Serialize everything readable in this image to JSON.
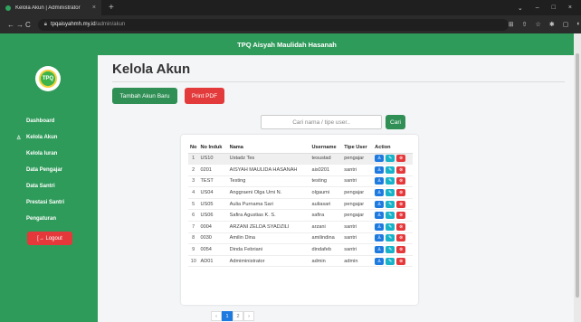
{
  "browser": {
    "tab_title": "Kelola Akun | Administrator",
    "tab_close": "×",
    "new_tab": "+",
    "url_host": "tpqaisyahmh.my.id",
    "url_path": "/admin/akun",
    "window_controls": [
      "⌄",
      "–",
      "□",
      "×"
    ]
  },
  "app": {
    "brand_title": "TPQ Aisyah Maulidah Hasanah",
    "logo_text": "TPQ",
    "sidebar": {
      "items": [
        {
          "label": "Dashboard",
          "icon": ""
        },
        {
          "label": "Kelola Akun",
          "icon": "user-icon"
        },
        {
          "label": "Kelola Iuran",
          "icon": ""
        },
        {
          "label": "Data Pengajar",
          "icon": ""
        },
        {
          "label": "Data Santri",
          "icon": ""
        },
        {
          "label": "Prestasi Santri",
          "icon": ""
        },
        {
          "label": "Pengaturan",
          "icon": ""
        }
      ],
      "logout_label": "[→ Logout"
    },
    "page_title": "Kelola Akun",
    "buttons": {
      "add_account": "Tambah Akun Baru",
      "print_pdf": "Print PDF"
    },
    "search": {
      "placeholder": "Cari nama / tipe user..",
      "button": "Cari"
    },
    "table": {
      "columns": [
        "No",
        "No Induk",
        "Nama",
        "Username",
        "Tipe User",
        "Action"
      ],
      "rows": [
        {
          "no": "1",
          "induk": "US10",
          "nama": "Ustadz Tes",
          "username": "tesustad",
          "tipe": "pengajar"
        },
        {
          "no": "2",
          "induk": "0201",
          "nama": "AISYAH MAULIDA HASANAH",
          "username": "ais0201",
          "tipe": "santri"
        },
        {
          "no": "3",
          "induk": "TEST",
          "nama": "Testing",
          "username": "testing",
          "tipe": "santri"
        },
        {
          "no": "4",
          "induk": "US04",
          "nama": "Anggraeni Olga Umi N.",
          "username": "olgaumi",
          "tipe": "pengajar"
        },
        {
          "no": "5",
          "induk": "US05",
          "nama": "Aulia Purnama Sari",
          "username": "auliasari",
          "tipe": "pengajar"
        },
        {
          "no": "6",
          "induk": "US06",
          "nama": "Safira Agustias K. S.",
          "username": "safira",
          "tipe": "pengajar"
        },
        {
          "no": "7",
          "induk": "0004",
          "nama": "ARZANI ZELDA SYADZILI",
          "username": "arzani",
          "tipe": "santri"
        },
        {
          "no": "8",
          "induk": "0030",
          "nama": "Amilin Dina",
          "username": "amilindina",
          "tipe": "santri"
        },
        {
          "no": "9",
          "induk": "0054",
          "nama": "Dinda Febriani",
          "username": "dindafeb",
          "tipe": "santri"
        },
        {
          "no": "10",
          "induk": "AD01",
          "nama": "Admiministrator",
          "username": "admin",
          "tipe": "admin"
        }
      ]
    },
    "pagination": {
      "prev": "‹",
      "current": "1",
      "next_page": "2",
      "next": "›"
    },
    "colors": {
      "primary_green": "#2f9b5a",
      "danger": "#e5383b",
      "info": "#1f7ae0",
      "cyan": "#19b3c9"
    }
  }
}
